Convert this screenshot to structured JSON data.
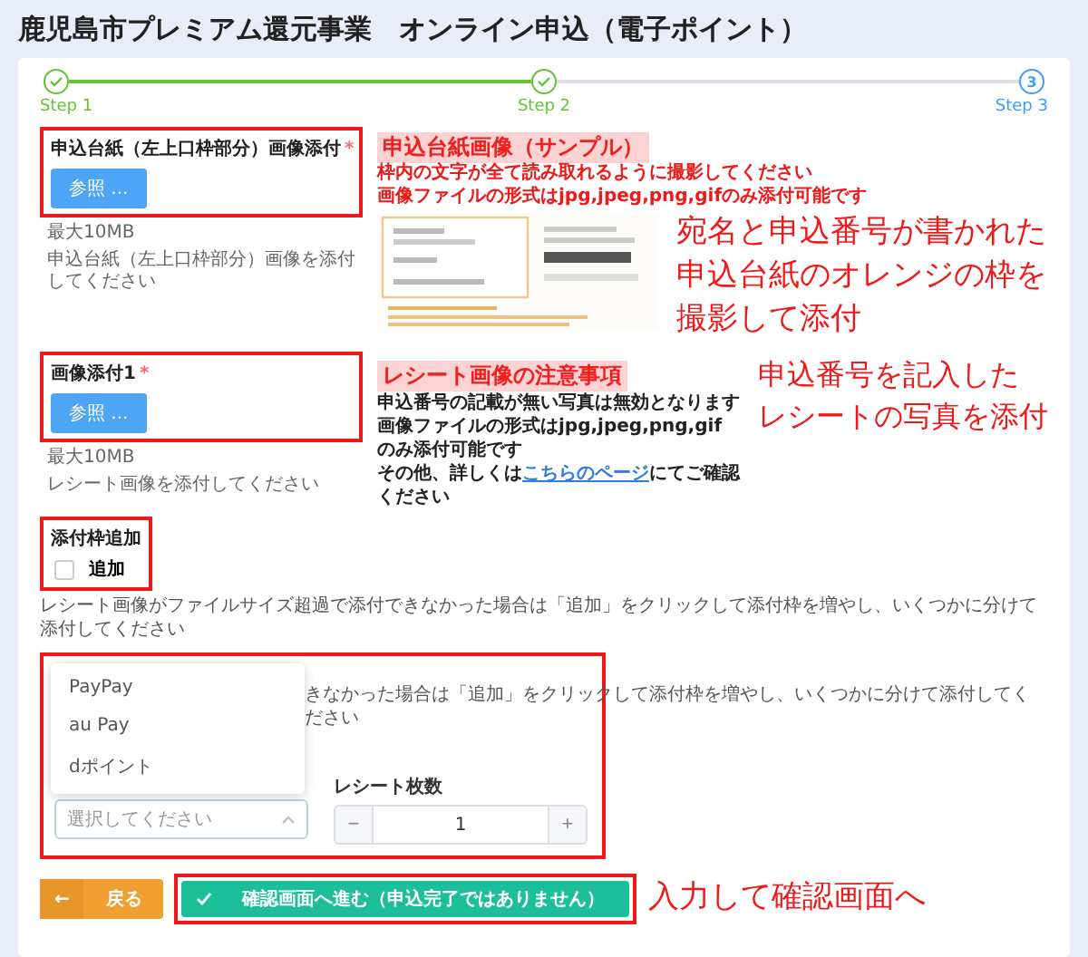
{
  "title": "鹿児島市プレミアム還元事業　オンライン申込（電子ポイント）",
  "steps": [
    {
      "label": "Step 1",
      "done": true
    },
    {
      "label": "Step 2",
      "done": true
    },
    {
      "label": "Step 3",
      "done": false,
      "number": "3"
    }
  ],
  "uploads": [
    {
      "label": "申込台紙（左上口枠部分）画像添付",
      "required_mark": "*",
      "button": "参照 ...",
      "max": "最大10MB",
      "hint": "申込台紙（左上口枠部分）画像を添付してください",
      "heading": "申込台紙画像（サンプル）",
      "notes": [
        "枠内の文字が全て読み取れるように撮影してください",
        "画像ファイルの形式はjpg,jpeg,png,gifのみ添付可能です"
      ],
      "kind": "sample",
      "annotation": [
        "宛名と申込番号が書かれた",
        "申込台紙のオレンジの枠を",
        "撮影して添付"
      ]
    },
    {
      "label": "画像添付1",
      "required_mark": "*",
      "button": "参照 ...",
      "max": "最大10MB",
      "hint": "レシート画像を添付してください",
      "heading": "レシート画像の注意事項",
      "notes": [
        "申込番号の記載が無い写真は無効となります",
        "画像ファイルの形式はjpg,jpeg,png,gifのみ添付可能です"
      ],
      "link_sentence": {
        "before": "その他、詳しくは",
        "link": "こちらのページ",
        "after": "にてご確認ください"
      },
      "kind": "notes",
      "annotation": [
        "申込番号を記入した",
        "レシートの写真を添付"
      ]
    }
  ],
  "add_frame": {
    "label": "添付枠追加",
    "checkbox": "追加",
    "checked": false,
    "note": "レシート画像がファイルサイズ超過で添付できなかった場合は「追加」をクリックして添付枠を増やし、いくつかに分けて添付してください"
  },
  "second_panel": {
    "note_visible": "きなかった場合は「追加」をクリックして添付枠を増やし、いくつかに分けて添付してください",
    "dropdown_options": [
      "PayPay",
      "au Pay",
      "dポイント"
    ],
    "select_placeholder": "選択してください",
    "count_label": "レシート枚数",
    "minus": "−",
    "count": "1",
    "plus": "+"
  },
  "buttons": {
    "back_arrow": "←",
    "back": "戻る",
    "confirm": "確認画面へ進む（申込完了ではありません）"
  },
  "footer_annotation": "入力して確認画面へ"
}
